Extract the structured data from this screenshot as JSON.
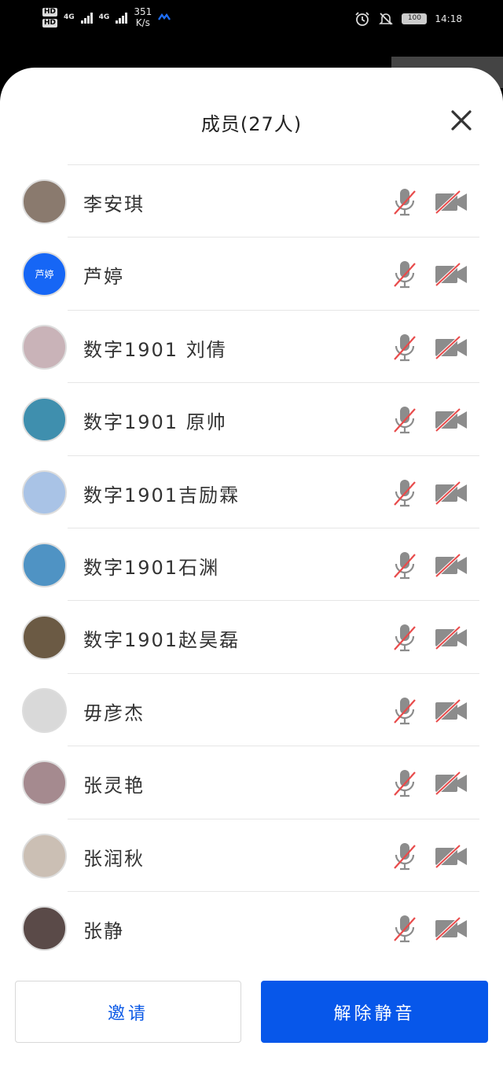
{
  "status_bar": {
    "hd1": "HD",
    "hd2": "HD",
    "net1": "4G",
    "net2": "4G",
    "speed_value": "351",
    "speed_unit": "K/s",
    "battery": "100",
    "time": "14:18"
  },
  "dialog": {
    "title": "成员(27人)",
    "members": [
      {
        "name": "李安琪",
        "avatar_color": "#8a7a6e",
        "avatar_text": ""
      },
      {
        "name": "芦婷",
        "avatar_color": "#1666f5",
        "avatar_text": "芦婷"
      },
      {
        "name": "数字1901 刘倩",
        "avatar_color": "#c9b3b8",
        "avatar_text": ""
      },
      {
        "name": "数字1901 原帅",
        "avatar_color": "#3f8fae",
        "avatar_text": ""
      },
      {
        "name": "数字1901吉励霖",
        "avatar_color": "#a9c3e6",
        "avatar_text": ""
      },
      {
        "name": "数字1901石渊",
        "avatar_color": "#4f93c4",
        "avatar_text": ""
      },
      {
        "name": "数字1901赵昊磊",
        "avatar_color": "#6b5a44",
        "avatar_text": ""
      },
      {
        "name": "毋彦杰",
        "avatar_color": "#d9d9d9",
        "avatar_text": ""
      },
      {
        "name": "张灵艳",
        "avatar_color": "#a58a8f",
        "avatar_text": ""
      },
      {
        "name": "张润秋",
        "avatar_color": "#cbbfb4",
        "avatar_text": ""
      },
      {
        "name": "张静",
        "avatar_color": "#5a4a48",
        "avatar_text": ""
      }
    ],
    "invite_label": "邀请",
    "unmute_label": "解除静音"
  },
  "colors": {
    "accent": "#0757ea",
    "muted_slash": "#e84b4b",
    "icon_gray": "#8c8c8c"
  },
  "icons": [
    "close-icon",
    "mic-muted-icon",
    "camera-off-icon",
    "signal-icon",
    "alarm-icon",
    "bell-off-icon"
  ]
}
